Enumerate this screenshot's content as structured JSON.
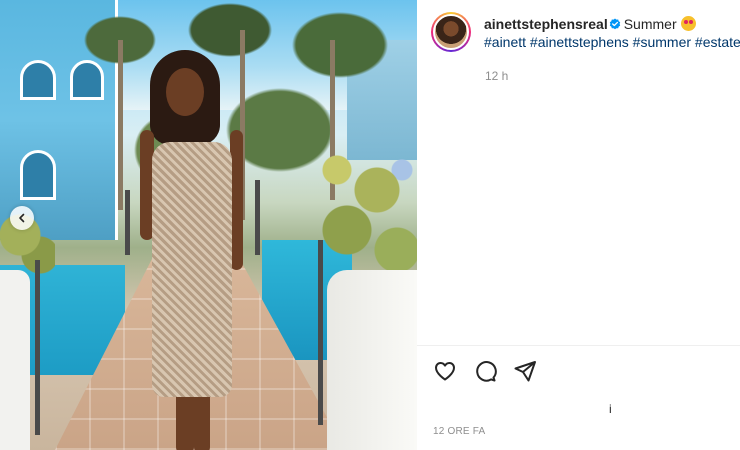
{
  "post": {
    "username": "ainettstephensreal",
    "verified_icon": "verified-badge-icon",
    "caption_text": "Summer",
    "caption_emoji": "star-struck-emoji",
    "hashtags": "#ainett #ainettstephens #summer #estate",
    "caption_time": "12 h",
    "date_label": "12 ORE FA",
    "more_indicator": "i"
  },
  "actions": {
    "like_icon": "heart-icon",
    "comment_icon": "comment-icon",
    "share_icon": "paper-plane-icon"
  },
  "media": {
    "prev_icon": "chevron-left-icon"
  },
  "colors": {
    "username": "#262626",
    "hashtag": "#00376b",
    "muted": "#8e8e8e",
    "verified": "#0095f6"
  }
}
